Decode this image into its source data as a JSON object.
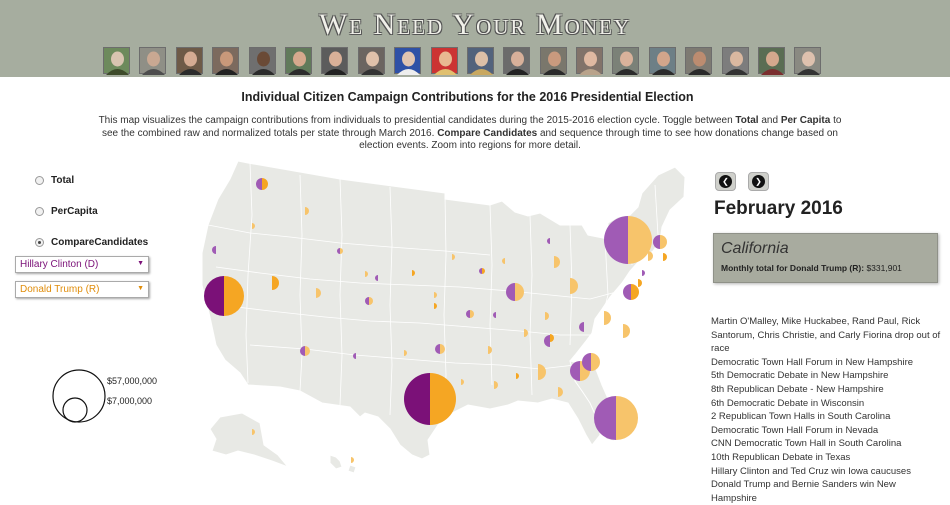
{
  "header": {
    "title": "We Need Your Money",
    "portraits": [
      {
        "name": "candidate-portrait-1",
        "bg": "#6d8a5c",
        "face": "#d8c4b0",
        "suit": "#3d4a2a"
      },
      {
        "name": "candidate-portrait-2",
        "bg": "#8f8f86",
        "face": "#c9a892",
        "suit": "#4d4d4d"
      },
      {
        "name": "candidate-portrait-3",
        "bg": "#6e5a47",
        "face": "#d5ab92",
        "suit": "#2b2b2b"
      },
      {
        "name": "candidate-portrait-4",
        "bg": "#7c6a5e",
        "face": "#c8987a",
        "suit": "#222"
      },
      {
        "name": "candidate-portrait-5",
        "bg": "#6f6f6f",
        "face": "#6a4a36",
        "suit": "#2b2b2b"
      },
      {
        "name": "candidate-portrait-6",
        "bg": "#617a5a",
        "face": "#d6a98d",
        "suit": "#2c2c2c"
      },
      {
        "name": "candidate-portrait-7",
        "bg": "#5c5c5c",
        "face": "#d9b098",
        "suit": "#222"
      },
      {
        "name": "candidate-portrait-8",
        "bg": "#6b6560",
        "face": "#dfc1aa",
        "suit": "#333"
      },
      {
        "name": "candidate-portrait-9",
        "bg": "#2f51a6",
        "face": "#e0c4b1",
        "suit": "#eee"
      },
      {
        "name": "candidate-portrait-10",
        "bg": "#c33",
        "face": "#e8b891",
        "suit": "#e0c070"
      },
      {
        "name": "candidate-portrait-11",
        "bg": "#52627c",
        "face": "#ddbfa7",
        "suit": "#c9a860"
      },
      {
        "name": "candidate-portrait-12",
        "bg": "#6b6b6b",
        "face": "#d8b09a",
        "suit": "#222"
      },
      {
        "name": "candidate-portrait-13",
        "bg": "#7a776c",
        "face": "#c99a7e",
        "suit": "#2a2a2a"
      },
      {
        "name": "candidate-portrait-14",
        "bg": "#82736a",
        "face": "#e0b9a2",
        "suit": "#b9a38b"
      },
      {
        "name": "candidate-portrait-15",
        "bg": "#7b8178",
        "face": "#d9b29b",
        "suit": "#2b2b2b"
      },
      {
        "name": "candidate-portrait-16",
        "bg": "#6d7f86",
        "face": "#d2a58b",
        "suit": "#2b2b2b"
      },
      {
        "name": "candidate-portrait-17",
        "bg": "#7d7a72",
        "face": "#bc8c70",
        "suit": "#2a2a2a"
      },
      {
        "name": "candidate-portrait-18",
        "bg": "#7d7d7d",
        "face": "#dab8a0",
        "suit": "#333"
      },
      {
        "name": "candidate-portrait-19",
        "bg": "#5a6d53",
        "face": "#d4a88d",
        "suit": "#7a2e2e"
      },
      {
        "name": "candidate-portrait-20",
        "bg": "#8a8a82",
        "face": "#dec1ae",
        "suit": "#333"
      }
    ]
  },
  "page": {
    "heading": "Individual Citizen Campaign Contributions for the 2016 Presidential Election",
    "intro": {
      "t1": "This map visualizes the campaign contributions from individuals to presidential candidates during the 2015-2016 election cycle. Toggle between ",
      "b1": "Total",
      "t2": " and ",
      "b2": "Per Capita",
      "t3": " to see the combined raw and normalized totals per state through March 2016. ",
      "b3": "Compare Candidates",
      "t4": " and sequence through time to see how donations change based on election events. Zoom into regions for more detail."
    }
  },
  "controls": {
    "radios": [
      {
        "label": "Total",
        "checked": false
      },
      {
        "label": "PerCapita",
        "checked": false
      },
      {
        "label": "CompareCandidates",
        "checked": true
      }
    ],
    "candidate_a": {
      "value": "Hillary Clinton (D)",
      "color": "#7b1178"
    },
    "candidate_b": {
      "value": "Donald Trump (R)",
      "color": "#f5a623"
    }
  },
  "legend": {
    "large_label": "$57,000,000",
    "small_label": "$7,000,000"
  },
  "timeline": {
    "prev_icon": "chevron-left-icon",
    "next_icon": "chevron-right-icon",
    "month": "February 2016",
    "state": "California",
    "total_label": "Monthly total for Donald Trump (R):",
    "total_value": "$331,901",
    "events": [
      "Martin O'Malley, Mike Huckabee, Rand Paul, Rick Santorum, Chris Christie, and Carly Fiorina drop out of race",
      "Democratic Town Hall Forum in New Hampshire",
      "5th Democratic Debate in New Hampshire",
      "8th Republican Debate - New Hampshire",
      "6th Democratic Debate in Wisconsin",
      "2 Republican Town Halls in South Carolina",
      "Democratic Town Hall Forum in Nevada",
      "CNN Democratic Town Hall in South Carolina",
      "10th Republican Debate in Texas",
      "Hillary Clinton and Ted Cruz win Iowa caucuses",
      "Donald Trump and Bernie Sanders win New Hampshire"
    ]
  },
  "colors": {
    "clinton": "#7b1178",
    "clinton_light": "#a05bb5",
    "trump": "#f5a623",
    "trump_light": "#f7c46b",
    "land": "#e8e9e5",
    "border": "#ffffff"
  }
}
